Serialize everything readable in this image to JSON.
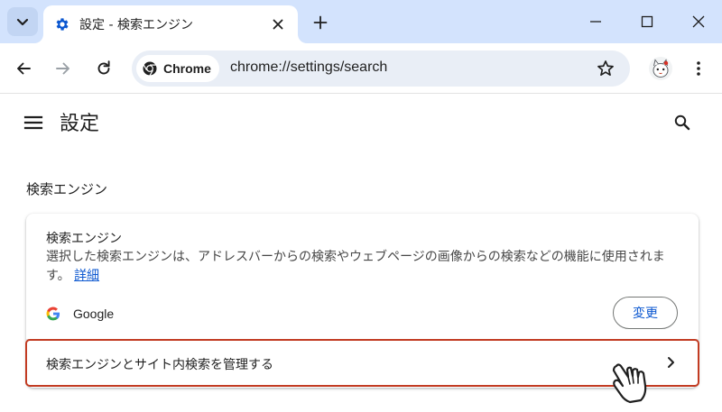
{
  "browser": {
    "tab": {
      "title": "設定 - 検索エンジン"
    },
    "omnibox": {
      "chip_label": "Chrome",
      "url": "chrome://settings/search"
    }
  },
  "settings": {
    "page_title": "設定",
    "section_heading": "検索エンジン",
    "card": {
      "title": "検索エンジン",
      "description": "選択した検索エンジンは、アドレスバーからの検索やウェブページの画像からの検索などの機能に使用されます。",
      "learn_more": "詳細",
      "engine_name": "Google",
      "change_button": "変更",
      "manage_label": "検索エンジンとサイト内検索を管理する"
    }
  },
  "colors": {
    "tabstrip": "#d3e3fd",
    "accent_blue": "#0b57d0",
    "highlight_red": "#c23b22"
  }
}
